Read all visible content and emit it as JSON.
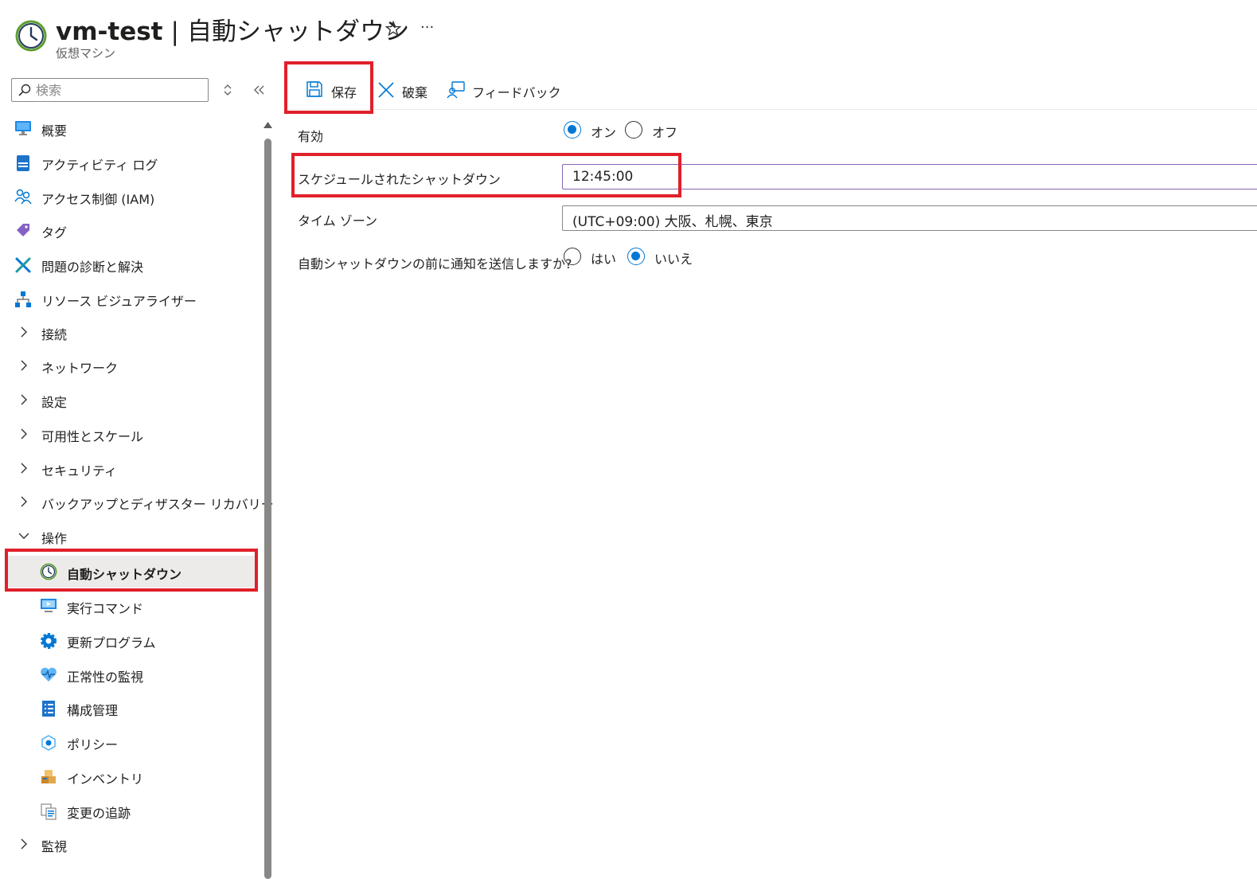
{
  "header": {
    "resource_name": "vm-test",
    "separator": "|",
    "page_title": "自動シャットダウン",
    "subtitle": "仮想マシン",
    "favorite_icon": "star-icon",
    "more_label": "···"
  },
  "sidebar": {
    "search_placeholder": "検索",
    "items": [
      {
        "label": "概要",
        "icon": "monitor-icon"
      },
      {
        "label": "アクティビティ ログ",
        "icon": "log-icon"
      },
      {
        "label": "アクセス制御 (IAM)",
        "icon": "people-icon"
      },
      {
        "label": "タグ",
        "icon": "tag-icon"
      },
      {
        "label": "問題の診断と解決",
        "icon": "wrench-icon"
      },
      {
        "label": "リソース ビジュアライザー",
        "icon": "hierarchy-icon"
      },
      {
        "label": "接続",
        "icon": "chevron-right-icon"
      },
      {
        "label": "ネットワーク",
        "icon": "chevron-right-icon"
      },
      {
        "label": "設定",
        "icon": "chevron-right-icon"
      },
      {
        "label": "可用性とスケール",
        "icon": "chevron-right-icon"
      },
      {
        "label": "セキュリティ",
        "icon": "chevron-right-icon"
      },
      {
        "label": "バックアップとディザスター リカバリー",
        "icon": "chevron-right-icon"
      },
      {
        "label": "操作",
        "icon": "chevron-down-icon"
      },
      {
        "label": "自動シャットダウン",
        "icon": "clock-icon"
      },
      {
        "label": "実行コマンド",
        "icon": "run-command-icon"
      },
      {
        "label": "更新プログラム",
        "icon": "gear-icon"
      },
      {
        "label": "正常性の監視",
        "icon": "heart-pulse-icon"
      },
      {
        "label": "構成管理",
        "icon": "checklist-icon"
      },
      {
        "label": "ポリシー",
        "icon": "policy-icon"
      },
      {
        "label": "インベントリ",
        "icon": "boxes-icon"
      },
      {
        "label": "変更の追跡",
        "icon": "documents-icon"
      },
      {
        "label": "監視",
        "icon": "chevron-right-icon"
      }
    ]
  },
  "toolbar": {
    "save_label": "保存",
    "discard_label": "破棄",
    "feedback_label": "フィードバック"
  },
  "form": {
    "enabled_label": "有効",
    "enabled_on_label": "オン",
    "enabled_off_label": "オフ",
    "schedule_label": "スケジュールされたシャットダウン",
    "schedule_value": "12:45:00",
    "timezone_label": "タイム ゾーン",
    "timezone_value": "(UTC+09:00) 大阪、札幌、東京",
    "notify_label": "自動シャットダウンの前に通知を送信しますか?",
    "notify_yes_label": "はい",
    "notify_no_label": "いいえ"
  },
  "colors": {
    "accent": "#0078d4",
    "highlight": "#e0202a",
    "selected_bg": "#edebe9"
  }
}
